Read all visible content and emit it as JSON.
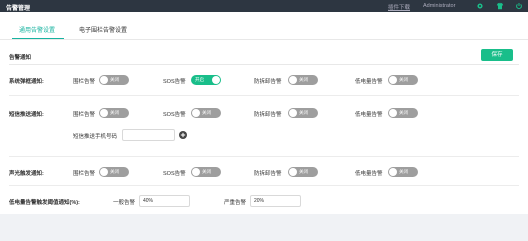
{
  "header": {
    "title": "告警管理",
    "download": "插件下载",
    "user": "Administrator"
  },
  "tabs": [
    {
      "label": "通用告警设置",
      "active": true
    },
    {
      "label": "电子围栏告警设置",
      "active": false
    }
  ],
  "section": {
    "title": "告警通知",
    "save_label": "保存"
  },
  "rows": [
    {
      "label": "系统弹框通知:",
      "items": [
        {
          "label": "围栏告警",
          "switch_text": "关闭",
          "state": "off"
        },
        {
          "label": "SOS告警",
          "switch_text": "开启",
          "state": "on"
        },
        {
          "label": "防拆卸告警",
          "switch_text": "关闭",
          "state": "off"
        },
        {
          "label": "低电量告警",
          "switch_text": "关闭",
          "state": "off"
        }
      ]
    },
    {
      "label": "短信推送通知:",
      "items": [
        {
          "label": "围栏告警",
          "switch_text": "关闭",
          "state": "off"
        },
        {
          "label": "SOS告警",
          "switch_text": "关闭",
          "state": "off"
        },
        {
          "label": "防拆卸告警",
          "switch_text": "关闭",
          "state": "off"
        },
        {
          "label": "低电量告警",
          "switch_text": "关闭",
          "state": "off"
        }
      ],
      "phone_label": "短信推送手机号码",
      "phone_value": ""
    },
    {
      "label": "声光触发通知:",
      "items": [
        {
          "label": "围栏告警",
          "switch_text": "关闭",
          "state": "off"
        },
        {
          "label": "SOS告警",
          "switch_text": "关闭",
          "state": "off"
        },
        {
          "label": "防拆卸告警",
          "switch_text": "关闭",
          "state": "off"
        },
        {
          "label": "低电量告警",
          "switch_text": "关闭",
          "state": "off"
        }
      ]
    }
  ],
  "threshold": {
    "label": "低电量告警触发阈值通知(%):",
    "general_label": "一般告警",
    "general_value": "40%",
    "severe_label": "严重告警",
    "severe_value": "20%"
  },
  "colors": {
    "accent": "#18b3a0",
    "switch_on": "#19be8a",
    "switch_off": "#9e9e9e",
    "topbar": "#2d3641"
  }
}
